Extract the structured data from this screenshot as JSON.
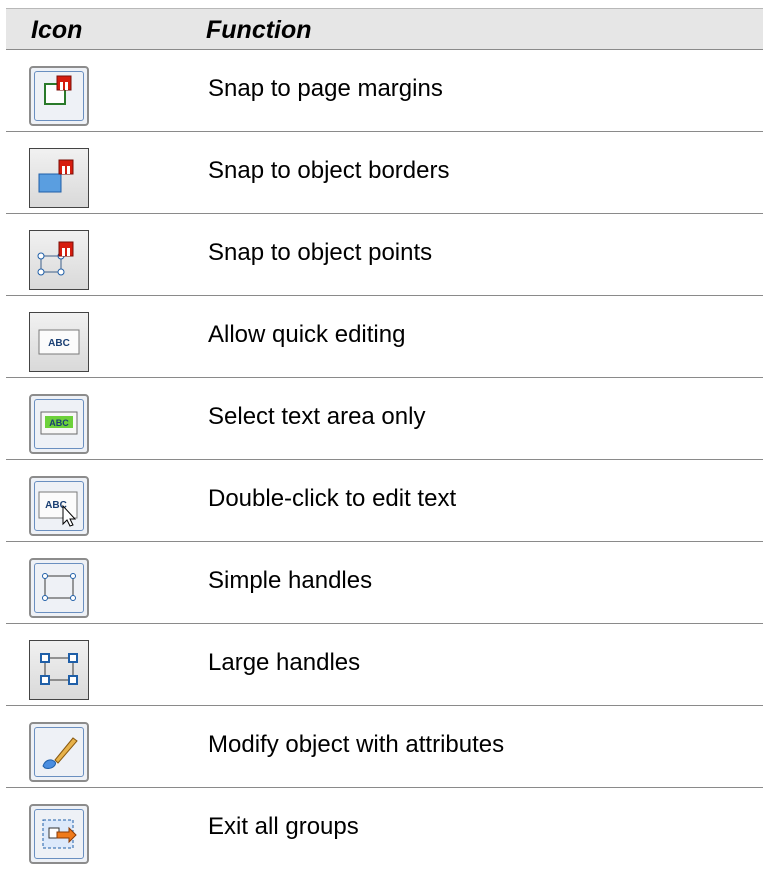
{
  "table": {
    "header": {
      "icon": "Icon",
      "function": "Function"
    },
    "rows": [
      {
        "icon": "snap-to-page-margins-icon",
        "label": "Snap to page margins"
      },
      {
        "icon": "snap-to-object-borders-icon",
        "label": "Snap to object borders"
      },
      {
        "icon": "snap-to-object-points-icon",
        "label": "Snap to object points"
      },
      {
        "icon": "allow-quick-editing-icon",
        "label": "Allow quick editing"
      },
      {
        "icon": "select-text-area-only-icon",
        "label": "Select text area only"
      },
      {
        "icon": "double-click-to-edit-text-icon",
        "label": "Double-click to edit text"
      },
      {
        "icon": "simple-handles-icon",
        "label": "Simple handles"
      },
      {
        "icon": "large-handles-icon",
        "label": "Large handles"
      },
      {
        "icon": "modify-object-with-attributes-icon",
        "label": "Modify object with attributes"
      },
      {
        "icon": "exit-all-groups-icon",
        "label": "Exit all groups"
      }
    ]
  },
  "icon_labels": {
    "abc": "ABC"
  }
}
